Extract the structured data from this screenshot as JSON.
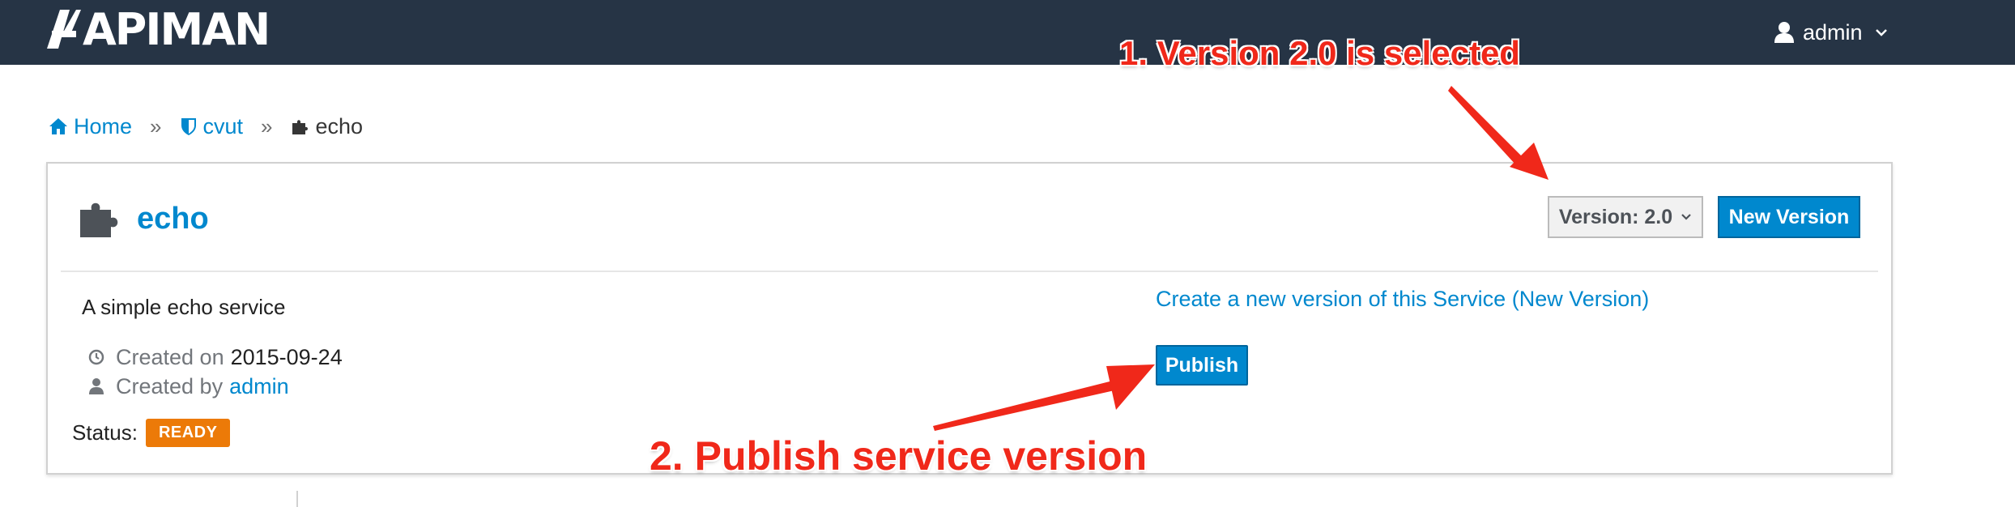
{
  "navbar": {
    "brand": "APIMAN",
    "user": "admin"
  },
  "breadcrumb": {
    "home": "Home",
    "org": "cvut",
    "service": "echo"
  },
  "service": {
    "name": "echo",
    "version_label": "Version: 2.0",
    "new_version_label": "New Version",
    "description": "A simple echo service",
    "created_on_label": "Created on",
    "created_on": "2015-09-24",
    "created_by_label": "Created by",
    "created_by": "admin",
    "status_label": "Status:",
    "status": "READY",
    "create_link": "Create a new version of this Service (New Version)",
    "publish_label": "Publish"
  },
  "annotations": {
    "step1": "1. Version 2.0 is selected",
    "step2": "2. Publish service version"
  },
  "colors": {
    "navbar": "#263445",
    "link": "#0088ce",
    "badge": "#ec7a08",
    "annotation": "#f0281a"
  }
}
